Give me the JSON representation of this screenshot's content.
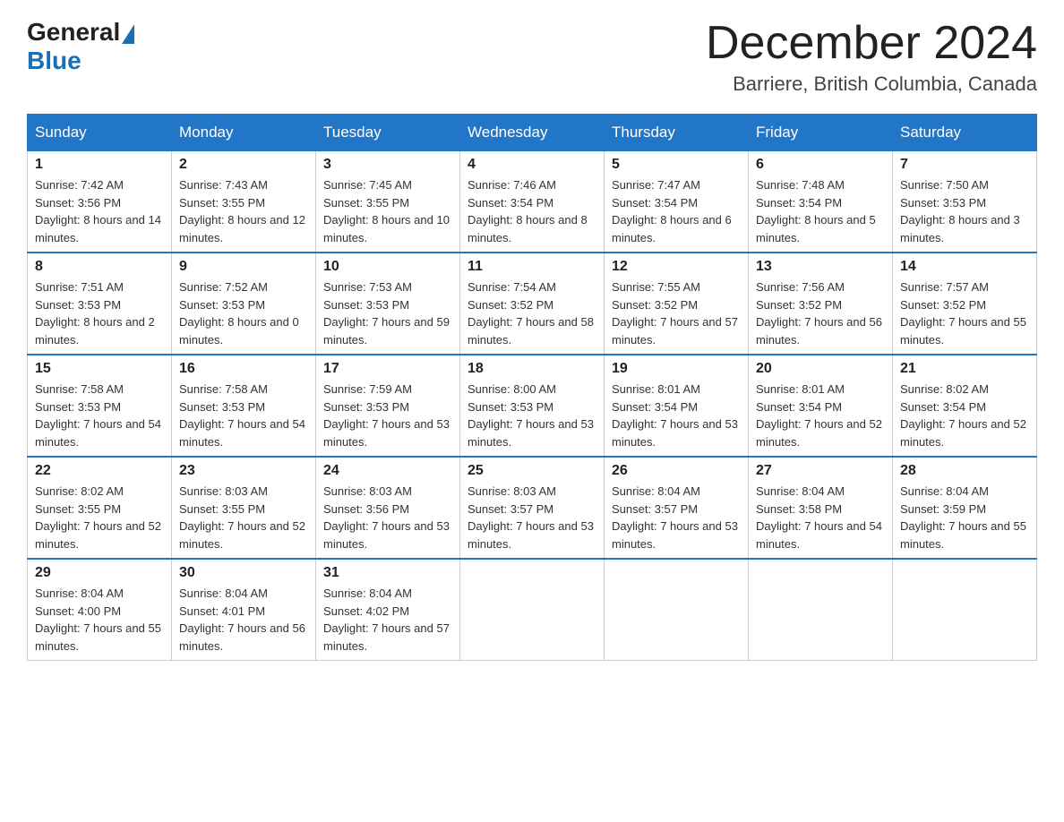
{
  "header": {
    "logo_general": "General",
    "logo_blue": "Blue",
    "month_title": "December 2024",
    "location": "Barriere, British Columbia, Canada"
  },
  "weekdays": [
    "Sunday",
    "Monday",
    "Tuesday",
    "Wednesday",
    "Thursday",
    "Friday",
    "Saturday"
  ],
  "weeks": [
    [
      {
        "day": "1",
        "sunrise": "7:42 AM",
        "sunset": "3:56 PM",
        "daylight": "8 hours and 14 minutes."
      },
      {
        "day": "2",
        "sunrise": "7:43 AM",
        "sunset": "3:55 PM",
        "daylight": "8 hours and 12 minutes."
      },
      {
        "day": "3",
        "sunrise": "7:45 AM",
        "sunset": "3:55 PM",
        "daylight": "8 hours and 10 minutes."
      },
      {
        "day": "4",
        "sunrise": "7:46 AM",
        "sunset": "3:54 PM",
        "daylight": "8 hours and 8 minutes."
      },
      {
        "day": "5",
        "sunrise": "7:47 AM",
        "sunset": "3:54 PM",
        "daylight": "8 hours and 6 minutes."
      },
      {
        "day": "6",
        "sunrise": "7:48 AM",
        "sunset": "3:54 PM",
        "daylight": "8 hours and 5 minutes."
      },
      {
        "day": "7",
        "sunrise": "7:50 AM",
        "sunset": "3:53 PM",
        "daylight": "8 hours and 3 minutes."
      }
    ],
    [
      {
        "day": "8",
        "sunrise": "7:51 AM",
        "sunset": "3:53 PM",
        "daylight": "8 hours and 2 minutes."
      },
      {
        "day": "9",
        "sunrise": "7:52 AM",
        "sunset": "3:53 PM",
        "daylight": "8 hours and 0 minutes."
      },
      {
        "day": "10",
        "sunrise": "7:53 AM",
        "sunset": "3:53 PM",
        "daylight": "7 hours and 59 minutes."
      },
      {
        "day": "11",
        "sunrise": "7:54 AM",
        "sunset": "3:52 PM",
        "daylight": "7 hours and 58 minutes."
      },
      {
        "day": "12",
        "sunrise": "7:55 AM",
        "sunset": "3:52 PM",
        "daylight": "7 hours and 57 minutes."
      },
      {
        "day": "13",
        "sunrise": "7:56 AM",
        "sunset": "3:52 PM",
        "daylight": "7 hours and 56 minutes."
      },
      {
        "day": "14",
        "sunrise": "7:57 AM",
        "sunset": "3:52 PM",
        "daylight": "7 hours and 55 minutes."
      }
    ],
    [
      {
        "day": "15",
        "sunrise": "7:58 AM",
        "sunset": "3:53 PM",
        "daylight": "7 hours and 54 minutes."
      },
      {
        "day": "16",
        "sunrise": "7:58 AM",
        "sunset": "3:53 PM",
        "daylight": "7 hours and 54 minutes."
      },
      {
        "day": "17",
        "sunrise": "7:59 AM",
        "sunset": "3:53 PM",
        "daylight": "7 hours and 53 minutes."
      },
      {
        "day": "18",
        "sunrise": "8:00 AM",
        "sunset": "3:53 PM",
        "daylight": "7 hours and 53 minutes."
      },
      {
        "day": "19",
        "sunrise": "8:01 AM",
        "sunset": "3:54 PM",
        "daylight": "7 hours and 53 minutes."
      },
      {
        "day": "20",
        "sunrise": "8:01 AM",
        "sunset": "3:54 PM",
        "daylight": "7 hours and 52 minutes."
      },
      {
        "day": "21",
        "sunrise": "8:02 AM",
        "sunset": "3:54 PM",
        "daylight": "7 hours and 52 minutes."
      }
    ],
    [
      {
        "day": "22",
        "sunrise": "8:02 AM",
        "sunset": "3:55 PM",
        "daylight": "7 hours and 52 minutes."
      },
      {
        "day": "23",
        "sunrise": "8:03 AM",
        "sunset": "3:55 PM",
        "daylight": "7 hours and 52 minutes."
      },
      {
        "day": "24",
        "sunrise": "8:03 AM",
        "sunset": "3:56 PM",
        "daylight": "7 hours and 53 minutes."
      },
      {
        "day": "25",
        "sunrise": "8:03 AM",
        "sunset": "3:57 PM",
        "daylight": "7 hours and 53 minutes."
      },
      {
        "day": "26",
        "sunrise": "8:04 AM",
        "sunset": "3:57 PM",
        "daylight": "7 hours and 53 minutes."
      },
      {
        "day": "27",
        "sunrise": "8:04 AM",
        "sunset": "3:58 PM",
        "daylight": "7 hours and 54 minutes."
      },
      {
        "day": "28",
        "sunrise": "8:04 AM",
        "sunset": "3:59 PM",
        "daylight": "7 hours and 55 minutes."
      }
    ],
    [
      {
        "day": "29",
        "sunrise": "8:04 AM",
        "sunset": "4:00 PM",
        "daylight": "7 hours and 55 minutes."
      },
      {
        "day": "30",
        "sunrise": "8:04 AM",
        "sunset": "4:01 PM",
        "daylight": "7 hours and 56 minutes."
      },
      {
        "day": "31",
        "sunrise": "8:04 AM",
        "sunset": "4:02 PM",
        "daylight": "7 hours and 57 minutes."
      },
      null,
      null,
      null,
      null
    ]
  ]
}
